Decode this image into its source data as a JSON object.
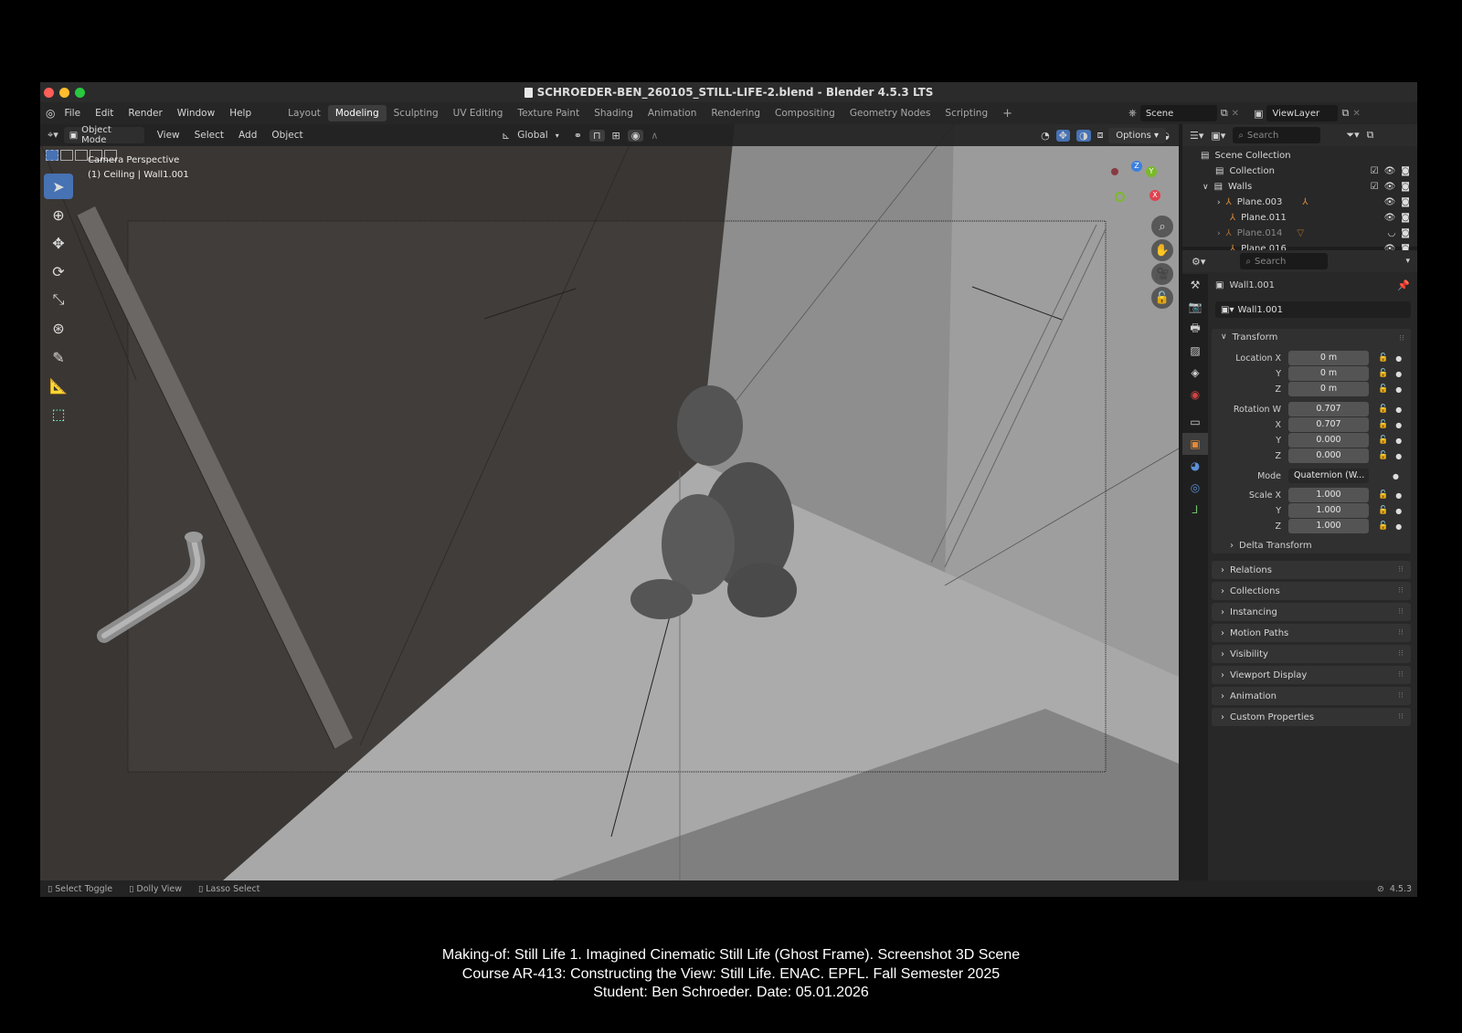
{
  "window": {
    "title": "SCHROEDER-BEN_260105_STILL-LIFE-2.blend - Blender 4.5.3 LTS"
  },
  "topbar": {
    "menus": [
      "File",
      "Edit",
      "Render",
      "Window",
      "Help"
    ],
    "workspaces": [
      "Layout",
      "Modeling",
      "Sculpting",
      "UV Editing",
      "Texture Paint",
      "Shading",
      "Animation",
      "Rendering",
      "Compositing",
      "Geometry Nodes",
      "Scripting"
    ],
    "active_workspace": "Modeling",
    "add_workspace": "+",
    "scene": "Scene",
    "view_layer": "ViewLayer"
  },
  "viewport": {
    "mode": "Object Mode",
    "menus": [
      "View",
      "Select",
      "Add",
      "Object"
    ],
    "transform_orientation": "Global",
    "overlay_line1": "Camera Perspective",
    "overlay_line2": "(1) Ceiling | Wall1.001",
    "options_label": "Options",
    "gizmo": {
      "z": "Z",
      "y": "Y",
      "x": "X"
    }
  },
  "outliner": {
    "search_placeholder": "Search",
    "root": "Scene Collection",
    "items": [
      {
        "name": "Collection"
      },
      {
        "name": "Walls"
      },
      {
        "name": "Plane.003"
      },
      {
        "name": "Plane.011"
      },
      {
        "name": "Plane.014"
      },
      {
        "name": "Plane.016"
      }
    ]
  },
  "properties": {
    "search_placeholder": "Search",
    "object_name": "Wall1.001",
    "datablock_name": "Wall1.001",
    "transform_title": "Transform",
    "labels": {
      "location_x": "Location X",
      "y": "Y",
      "z": "Z",
      "rotation_w": "Rotation W",
      "x": "X",
      "mode": "Mode",
      "scale_x": "Scale X"
    },
    "location": [
      "0 m",
      "0 m",
      "0 m"
    ],
    "rotation": [
      "0.707",
      "0.707",
      "0.000",
      "0.000"
    ],
    "rotation_mode": "Quaternion (W...",
    "scale": [
      "1.000",
      "1.000",
      "1.000"
    ],
    "delta_transform": "Delta Transform",
    "panels": [
      "Relations",
      "Collections",
      "Instancing",
      "Motion Paths",
      "Visibility",
      "Viewport Display",
      "Animation",
      "Custom Properties"
    ]
  },
  "statusbar": {
    "items": [
      "Select Toggle",
      "Dolly View",
      "Lasso Select"
    ],
    "version": "4.5.3"
  },
  "caption": {
    "line1": "Making-of: Still Life 1. Imagined Cinematic Still Life (Ghost Frame). Screenshot 3D Scene",
    "line2": "Course AR-413: Constructing the View: Still Life. ENAC. EPFL. Fall Semester 2025",
    "line3": "Student: Ben Schroeder. Date: 05.01.2026"
  },
  "colors": {
    "accent_blue": "#4772b3",
    "orange_object": "#e0893a",
    "gizmo_x": "#e0424f",
    "gizmo_y": "#7ab929",
    "gizmo_z": "#3b80e0"
  }
}
